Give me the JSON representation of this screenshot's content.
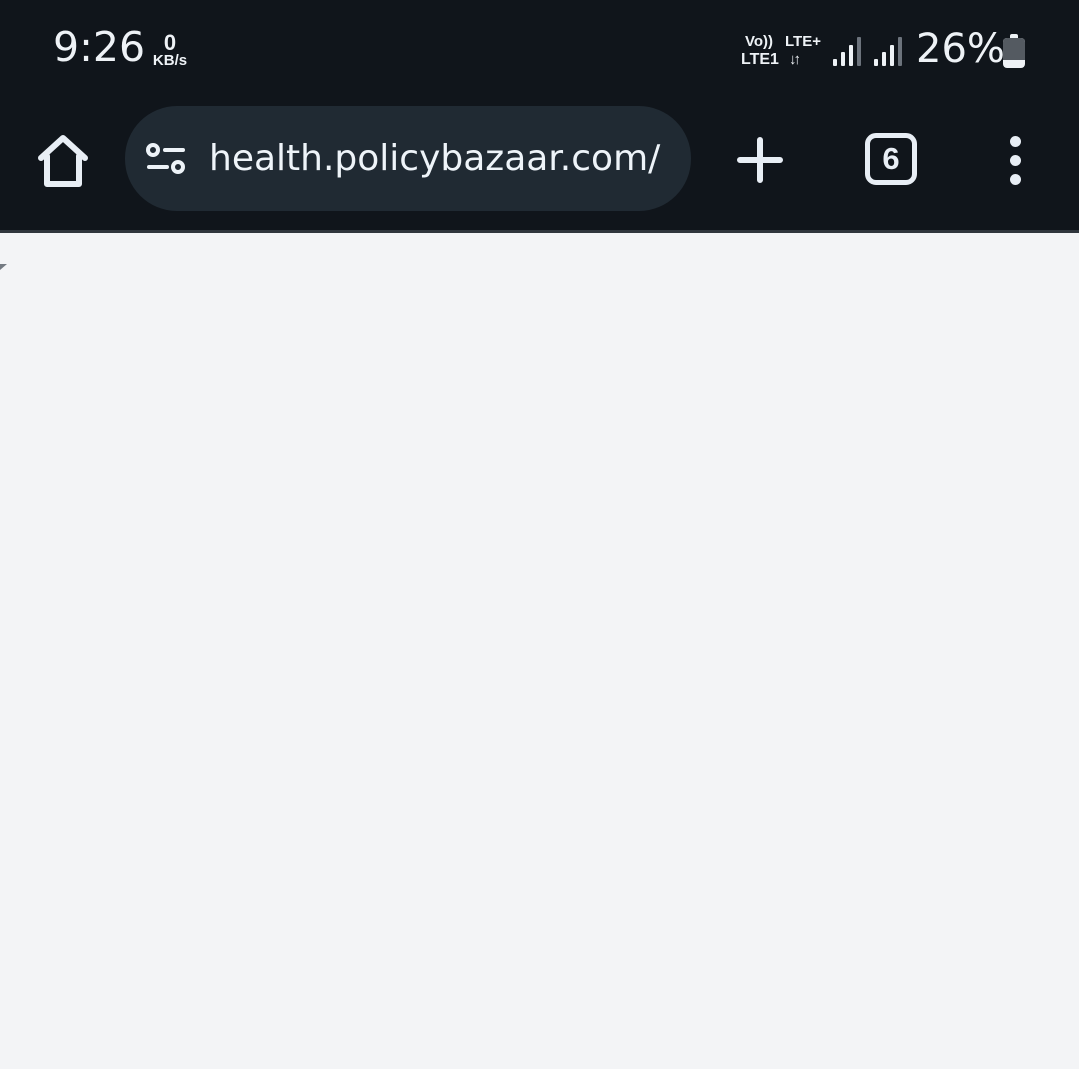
{
  "status_bar": {
    "time": "9:26",
    "network_speed_value": "0",
    "network_speed_unit": "KB/s",
    "volte": "Vo))",
    "lte_plus": "LTE+",
    "lte_sim": "LTE1",
    "data_arrows": "↓↑",
    "battery_percent": "26%",
    "battery_level_percent": 26,
    "signal_icons": [
      "signal-strength-icon",
      "signal-strength-icon"
    ]
  },
  "browser": {
    "url": "health.policybazaar.com/",
    "tab_count": "6",
    "icons": {
      "home": "home-icon",
      "site_settings": "site-settings-icon",
      "new_tab": "plus-icon",
      "tabs": "tab-switcher-icon",
      "menu": "more-vert-icon"
    }
  },
  "colors": {
    "status_background": "#10151b",
    "address_bar": "#202a33",
    "content_background": "#f3f4f6",
    "icon": "#e8eef5"
  }
}
